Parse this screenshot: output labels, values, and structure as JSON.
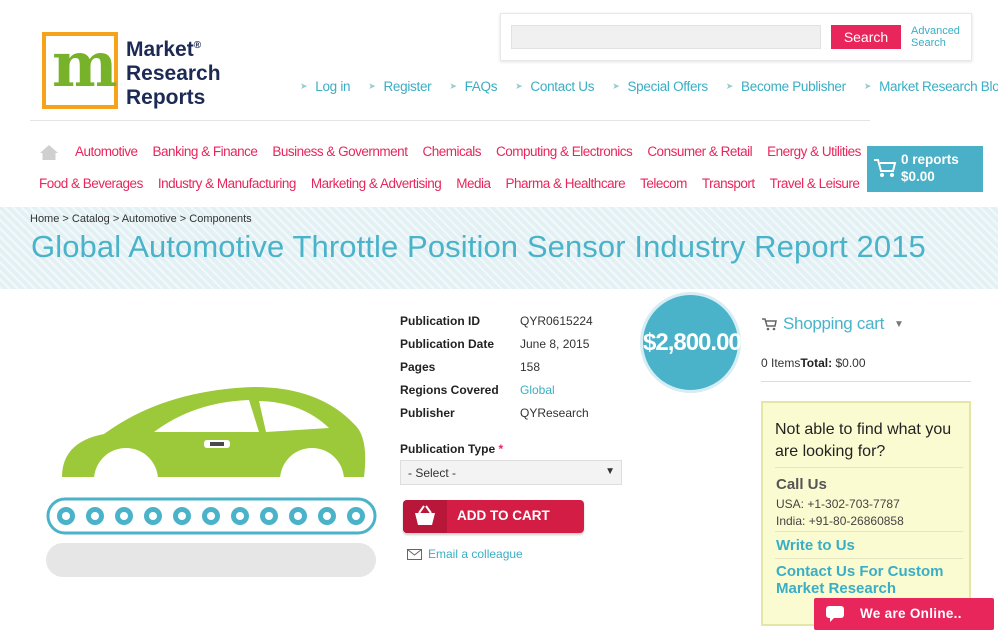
{
  "logo": {
    "mark": "m",
    "line1": "Market",
    "line2": "Research",
    "line3": "Reports",
    "reg": "®"
  },
  "search": {
    "placeholder": "",
    "button_label": "Search",
    "advanced_line1": "Advanced",
    "advanced_line2": "Search"
  },
  "top_links": [
    "Log in",
    "Register",
    "FAQs",
    "Contact Us",
    "Special Offers",
    "Become Publisher",
    "Market Research Blog"
  ],
  "categories_row1": [
    "Automotive",
    "Banking & Finance",
    "Business & Government",
    "Chemicals",
    "Computing & Electronics",
    "Consumer & Retail",
    "Energy & Utilities"
  ],
  "categories_row2": [
    "Food & Beverages",
    "Industry & Manufacturing",
    "Marketing & Advertising",
    "Media",
    "Pharma & Healthcare",
    "Telecom",
    "Transport",
    "Travel & Leisure"
  ],
  "cart": {
    "reports": "0 reports",
    "total": "$0.00"
  },
  "breadcrumb": "Home > Catalog > Automotive > Components",
  "title": "Global Automotive Throttle Position Sensor Industry Report 2015",
  "details": {
    "rows": [
      {
        "label": "Publication ID",
        "value": "QYR0615224"
      },
      {
        "label": "Publication Date",
        "value": "June 8, 2015"
      },
      {
        "label": "Pages",
        "value": "158"
      },
      {
        "label": "Regions Covered",
        "value": "Global"
      },
      {
        "label": "Publisher",
        "value": "QYResearch"
      }
    ]
  },
  "price": "$2,800.00",
  "pub_type": {
    "label": "Publication Type",
    "required": "*",
    "selected": "- Select -"
  },
  "add_to_cart": "ADD TO CART",
  "email_colleague": "Email a colleague",
  "shopping_cart": {
    "title": "Shopping cart",
    "items": "0 Items",
    "total_label": "Total:",
    "total_value": "$0.00"
  },
  "help": {
    "question": "Not able to find what you are looking for?",
    "call_us": "Call Us",
    "usa": "USA: +1-302-703-7787",
    "india": "India: +91-80-26860858",
    "write_to_us": "Write to Us",
    "custom": "Contact Us For Custom Market Research"
  },
  "chat": "We are Online..",
  "colors": {
    "accent_pink": "#e8265c",
    "accent_teal": "#4ab3c9",
    "car_green": "#9bc93a"
  },
  "icons": [
    "home-icon",
    "cart-icon",
    "email-icon",
    "chat-icon",
    "chevron-down-icon"
  ]
}
